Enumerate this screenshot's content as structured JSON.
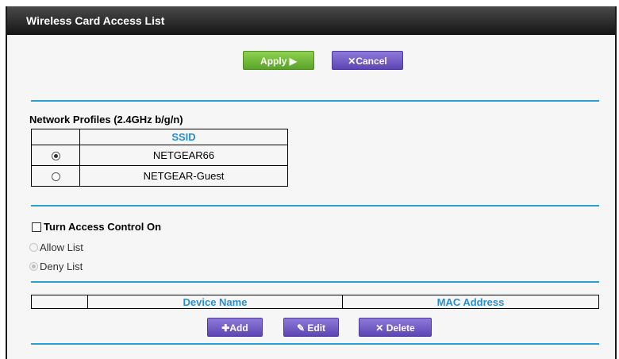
{
  "header": {
    "title": "Wireless Card Access List"
  },
  "actions": {
    "apply_label": "Apply ▶",
    "cancel_label": "Cancel",
    "cancel_icon": "✕"
  },
  "network_profiles": {
    "title": "Network Profiles (2.4GHz b/g/n)",
    "column_ssid": "SSID",
    "rows": [
      {
        "ssid": "NETGEAR66",
        "selected": true
      },
      {
        "ssid": "NETGEAR-Guest",
        "selected": false
      }
    ]
  },
  "access_control": {
    "toggle_label": "Turn Access Control On",
    "toggle_checked": false,
    "allow_label": "Allow List",
    "deny_label": "Deny List",
    "selected_mode": "deny"
  },
  "device_table": {
    "col_device_name": "Device Name",
    "col_mac_address": "MAC Address"
  },
  "device_actions": {
    "add_label": "Add",
    "edit_label": "Edit",
    "delete_label": "Delete"
  },
  "colors": {
    "accent_rule": "#2a9fd6",
    "apply_green": "#6bbf34",
    "button_purple": "#6a52c0",
    "header_text_blue": "#2a8dd0"
  }
}
